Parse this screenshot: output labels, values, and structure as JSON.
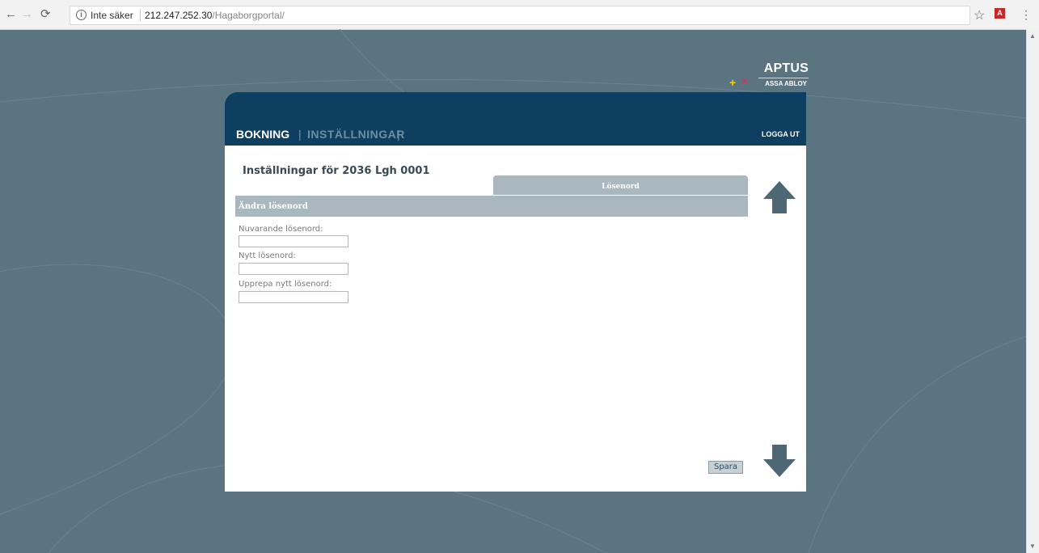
{
  "browser": {
    "insecure_label": "Inte säker",
    "url_host": "212.247.252.30",
    "url_path": "/Hagaborgportal/"
  },
  "logo": {
    "brand": "APTUS",
    "sub": "ASSA ABLOY"
  },
  "nav": {
    "bokning": "BOKNING",
    "installningar": "INSTÄLLNINGAR",
    "separator": "|",
    "logout": "LOGGA UT"
  },
  "page": {
    "title": "Inställningar för 2036 Lgh 0001",
    "tab_label": "Lösenord",
    "section_title": "Ändra lösenord",
    "fields": {
      "current": {
        "label": "Nuvarande lösenord:",
        "value": ""
      },
      "new": {
        "label": "Nytt lösenord:",
        "value": ""
      },
      "repeat": {
        "label": "Upprepa nytt lösenord:",
        "value": ""
      }
    },
    "save_label": "Spara"
  },
  "colors": {
    "page_bg": "#5b7482",
    "header_bg": "#0e3f60",
    "tab_bg": "#a9b7bf",
    "arrow": "#4d6775"
  },
  "icons": [
    "arrow-up-icon",
    "arrow-down-icon",
    "info-icon",
    "star-icon",
    "pdf-icon",
    "menu-icon"
  ]
}
